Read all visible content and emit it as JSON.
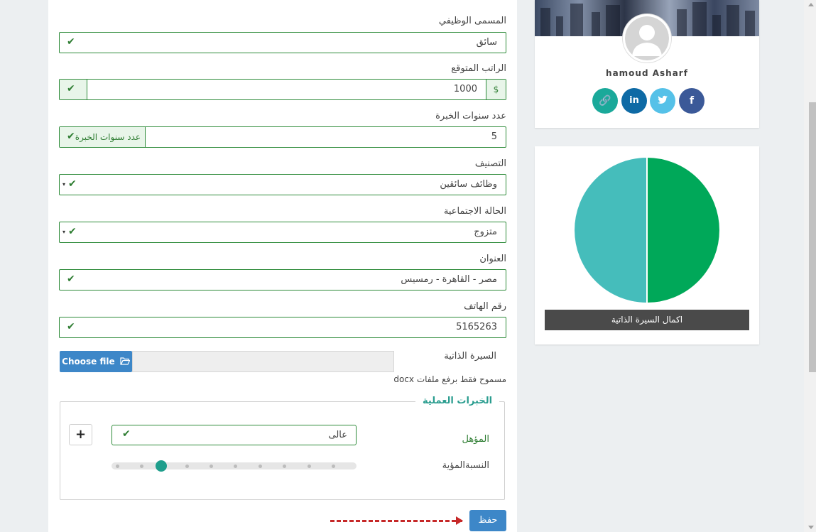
{
  "form": {
    "job_title": {
      "label": "المسمى الوظيفي",
      "value": "سائق"
    },
    "expected_salary": {
      "label": "الراتب المتوقع",
      "value": "1000",
      "addon": "$"
    },
    "experience_years": {
      "label": "عدد سنوات الخبرة",
      "value": "5",
      "addon": "عدد سنوات الخبرة"
    },
    "category": {
      "label": "التصنيف",
      "value": "وظائف سائقين"
    },
    "marital_status": {
      "label": "الحالة الاجتماعية",
      "value": "متزوج"
    },
    "address": {
      "label": "العنوان",
      "value": "مصر - القاهرة - رمسيس"
    },
    "phone": {
      "label": "رقم الهاتف",
      "value": "5165263"
    },
    "cv": {
      "label": "السيرة الذاتية",
      "button": "Choose file",
      "hint": "مسموح فقط برفع ملفات docx"
    },
    "experience_section": {
      "legend": "الخبرات العملية",
      "qualification_label": "المؤهل",
      "qualification_value": "عالى",
      "percentage_label": "النسبةالمؤية",
      "percentage_value": 0.2
    },
    "save_label": "حفظ"
  },
  "profile": {
    "name": "hamoud Asharf",
    "social_icons": [
      "link-icon",
      "linkedin-icon",
      "twitter-icon",
      "facebook-icon"
    ],
    "social_glyphs": {
      "link": "🔗",
      "linkedin": "in",
      "twitter": "🐦",
      "facebook": "f"
    },
    "colors": {
      "link": "#1aa99a",
      "linkedin": "#0e6aa5",
      "twitter": "#55c1e8",
      "facebook": "#3b5998"
    }
  },
  "chart_data": {
    "type": "pie",
    "title": "",
    "caption": "اكمال السيرة الذاتية",
    "values": [
      50,
      50
    ],
    "colors": [
      "#00a859",
      "#45bdbb"
    ]
  },
  "check_glyph": "✔",
  "caret_glyph": "▾",
  "plus_glyph": "+"
}
